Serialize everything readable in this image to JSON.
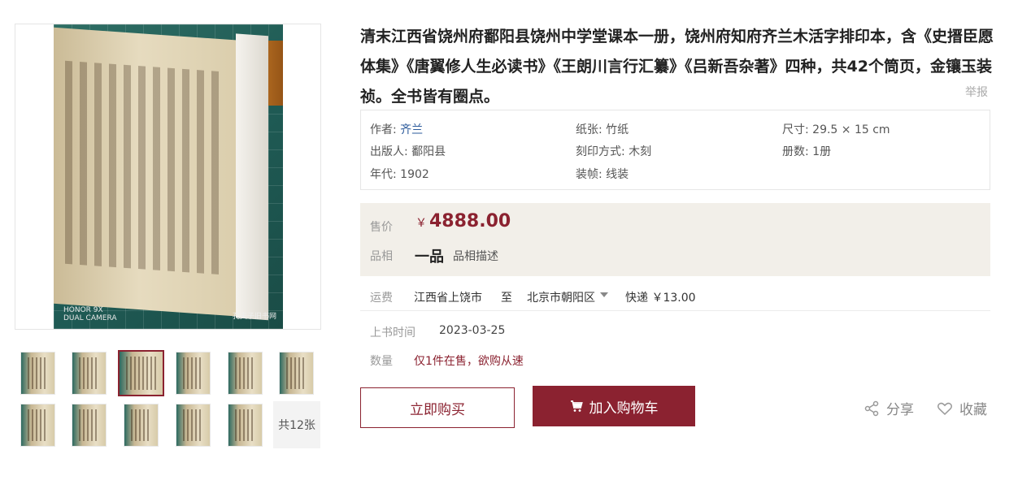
{
  "gallery": {
    "main_watermark_left": "HONOR 9X\nDUAL CAMERA",
    "main_watermark_right": "孔夫子旧书网",
    "total_label": "共12张"
  },
  "product": {
    "title": "清末江西省饶州府鄱阳县饶州中学堂课本一册，饶州府知府齐兰木活字排印本，含《史搢臣愿体集》《唐翼修人生必读书》《王朗川言行汇纂》《吕新吾杂著》四种，共42个筒页，金镶玉装祯。全书皆有圈点。",
    "report": "举报"
  },
  "attributes": {
    "author_label": "作者: ",
    "author_value": "齐兰",
    "paper": "纸张: 竹纸",
    "size": "尺寸: 29.5 × 15 cm",
    "publisher": "出版人: 鄱阳县",
    "print_method": "刻印方式: 木刻",
    "volumes": "册数: 1册",
    "year": "年代: 1902",
    "binding": "装帧: 线装"
  },
  "pricing": {
    "price_label": "售价",
    "currency": "￥",
    "price": "4888.00",
    "condition_label": "品相",
    "condition": "一品",
    "condition_desc": "品相描述"
  },
  "shipping": {
    "label": "运费",
    "from": "江西省上饶市",
    "to_word": "至",
    "to": "北京市朝阳区",
    "method": "快递 ￥13.00"
  },
  "listing": {
    "time_label": "上书时间",
    "time_value": "2023-03-25",
    "qty_label": "数量",
    "qty_value": "仅1件在售，欲购从速"
  },
  "actions": {
    "buy": "立即购买",
    "cart": "加入购物车",
    "share": "分享",
    "favorite": "收藏"
  },
  "colors": {
    "accent": "#8b2230",
    "price_bg": "#f2efe9",
    "link": "#2b5a9b"
  }
}
